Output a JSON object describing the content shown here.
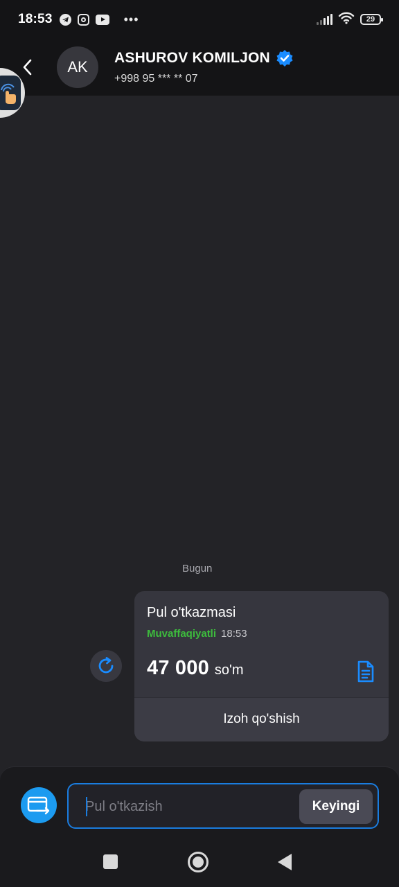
{
  "status_bar": {
    "time": "18:53",
    "battery": "29",
    "more": "•••"
  },
  "header": {
    "avatar_initials": "AK",
    "name": "ASHUROV KOMILJON",
    "phone": "+998 95 *** ** 07",
    "verified_color": "#1a8cff"
  },
  "chat": {
    "date_label": "Bugun",
    "transfer_card": {
      "title": "Pul o'tkazmasi",
      "status": "Muvaffaqiyatli",
      "time": "18:53",
      "amount": "47 000",
      "currency": "so'm",
      "comment_label": "Izoh qo'shish",
      "status_color": "#3dbd3d"
    }
  },
  "input": {
    "placeholder": "Pul o'tkazish",
    "value": "",
    "next_label": "Keyingi"
  },
  "icons": {
    "back": "back-arrow-icon",
    "verified": "verified-badge-icon",
    "retry": "refresh-icon",
    "receipt": "receipt-icon",
    "transfer": "card-transfer-icon"
  },
  "colors": {
    "accent": "#1a7de0",
    "fab": "#1c9bf0",
    "background": "#232327",
    "card": "#36363e"
  }
}
